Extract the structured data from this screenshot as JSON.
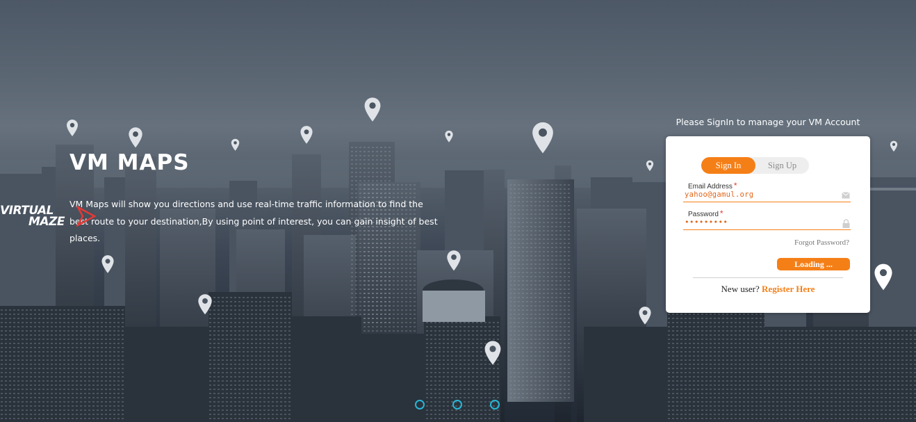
{
  "hero": {
    "title": "VM MAPS",
    "description": "VM Maps will show you directions and use real-time traffic information to find the best route to your destination,By using point of interest, you can gain insight of best places."
  },
  "logo": {
    "line1": "VIRTUAL",
    "line2": "MAZE",
    "accent_color": "#e53935"
  },
  "signin": {
    "caption": "Please SignIn to manage your VM Account",
    "tabs": [
      {
        "label": "Sign In",
        "active": true
      },
      {
        "label": "Sign Up",
        "active": false
      }
    ],
    "email": {
      "label": "Email Address",
      "required_mark": "*",
      "value": "yahoo@gamul.org",
      "icon": "envelope-icon"
    },
    "password": {
      "label": "Password",
      "required_mark": "*",
      "value": "•••••••••",
      "icon": "lock-icon"
    },
    "forgot_label": "Forgot Password?",
    "submit_label": "Loading ...",
    "new_user_text": "New user?",
    "register_label": "Register Here",
    "accent_color": "#f57f17"
  },
  "carousel": {
    "dot_count": 3,
    "dot_color": "#27b7d6"
  }
}
